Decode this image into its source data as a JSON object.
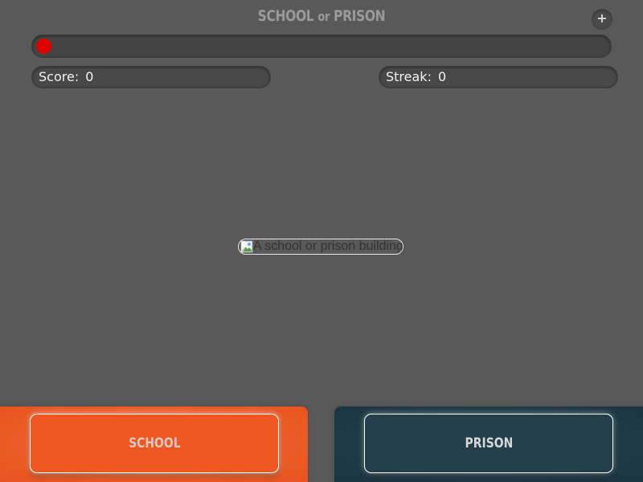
{
  "header": {
    "title_part1": "SCHOOL",
    "title_or": "or",
    "title_part2": "PRISON",
    "plus_label": "+"
  },
  "timer": {
    "remaining_fraction": 1.0,
    "indicator_color": "#e00000"
  },
  "stats": {
    "score_label": "Score:",
    "score_value": "0",
    "streak_label": "Streak:",
    "streak_value": "0"
  },
  "photo": {
    "alt_text": "A school or prison building"
  },
  "choices": {
    "school_label": "SCHOOL",
    "prison_label": "PRISON",
    "school_color": "#ee5722",
    "prison_color": "#223f4b"
  }
}
